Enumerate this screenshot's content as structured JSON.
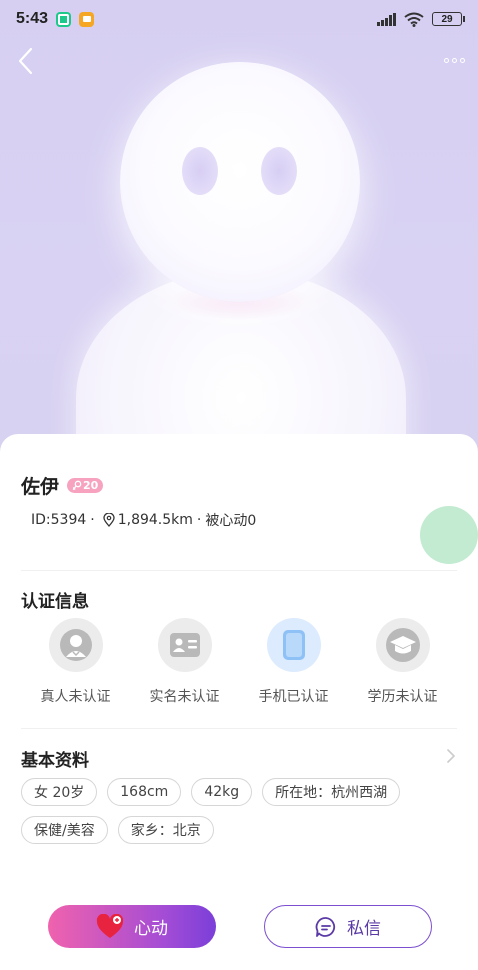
{
  "status_bar": {
    "time": "5:43",
    "battery": "29"
  },
  "profile": {
    "name": "佐伊",
    "age_badge": "20",
    "id_text": "ID:5394",
    "distance": "1,894.5km",
    "likes_text": "被心动0"
  },
  "verification": {
    "title": "认证信息",
    "items": [
      {
        "label": "真人未认证",
        "icon": "person-icon",
        "verified": false
      },
      {
        "label": "实名未认证",
        "icon": "id-card-icon",
        "verified": false
      },
      {
        "label": "手机已认证",
        "icon": "phone-icon",
        "verified": true
      },
      {
        "label": "学历未认证",
        "icon": "graduation-cap-icon",
        "verified": false
      }
    ]
  },
  "basic_info": {
    "title": "基本资料",
    "tags": [
      "女 20岁",
      "168cm",
      "42kg",
      "所在地：杭州西湖",
      "保健/美容",
      "家乡：北京"
    ]
  },
  "actions": {
    "like_label": "心动",
    "message_label": "私信"
  },
  "colors": {
    "accent_pink": "#f062ad",
    "accent_purple": "#7b3fd8",
    "verified_blue": "#9ec9f7",
    "float_green": "#c2ebd1"
  }
}
